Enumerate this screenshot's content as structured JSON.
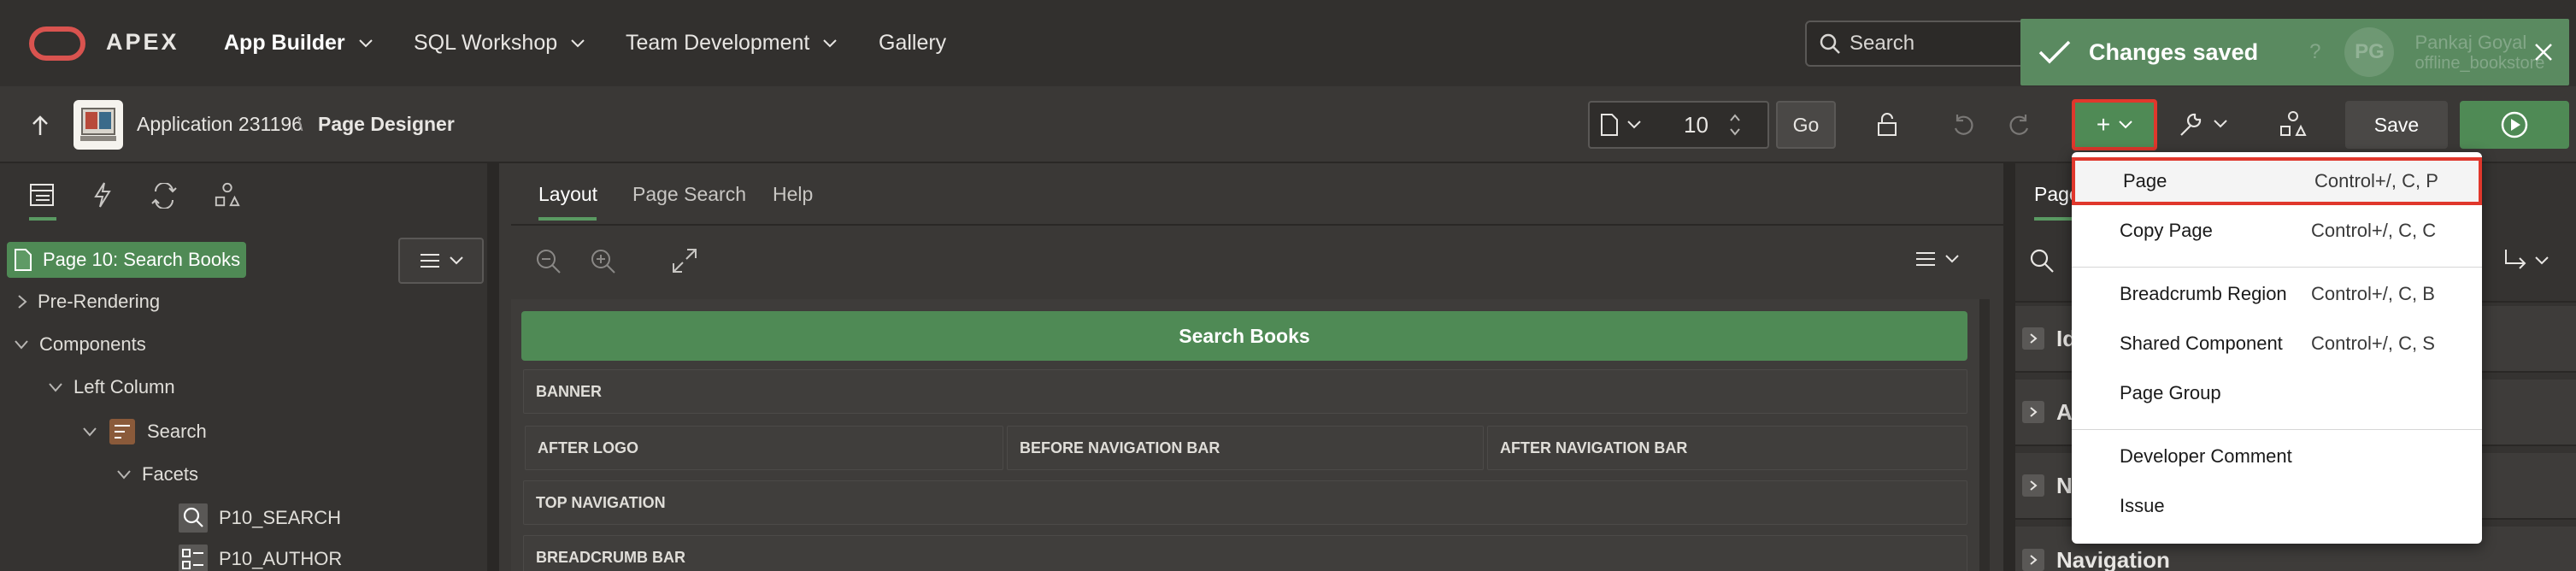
{
  "topnav": {
    "brand": "APEX",
    "items": [
      {
        "label": "App Builder",
        "has_menu": true
      },
      {
        "label": "SQL Workshop",
        "has_menu": true
      },
      {
        "label": "Team Development",
        "has_menu": true
      },
      {
        "label": "Gallery",
        "has_menu": false
      }
    ],
    "search_placeholder": "Search",
    "user_name": "Pankaj Goyal",
    "user_initials": "PG",
    "user_workspace": "offline_bookstore"
  },
  "toast": {
    "message": "Changes saved"
  },
  "toolbar": {
    "app_name": "Application 231196",
    "separator": "\\",
    "current": "Page Designer",
    "page_number": "10",
    "go_label": "Go",
    "save_label": "Save",
    "create_symbol": "+"
  },
  "left_panel": {
    "page_chip": "Page 10: Search Books",
    "tree": [
      {
        "label": "Pre-Rendering"
      },
      {
        "label": "Components"
      },
      {
        "label": "Left Column"
      },
      {
        "label": "Search"
      },
      {
        "label": "Facets"
      },
      {
        "label": "P10_SEARCH"
      },
      {
        "label": "P10_AUTHOR"
      }
    ]
  },
  "center_panel": {
    "tabs": [
      "Layout",
      "Page Search",
      "Help"
    ],
    "active_tab": "Layout",
    "page_title": "Search Books",
    "regions": {
      "banner": "BANNER",
      "after_logo": "AFTER LOGO",
      "before_nav": "BEFORE NAVIGATION BAR",
      "after_nav": "AFTER NAVIGATION BAR",
      "top_nav": "TOP NAVIGATION",
      "breadcrumb": "BREADCRUMB BAR"
    }
  },
  "right_panel": {
    "tab_partial": "Page",
    "sections": [
      {
        "label": "Id"
      },
      {
        "label": "Ap"
      },
      {
        "label": "Na"
      },
      {
        "label": "Navigation"
      }
    ]
  },
  "create_menu": {
    "items": [
      {
        "label": "Page",
        "shortcut": "Control+/, C, P",
        "highlighted": true
      },
      {
        "label": "Copy Page",
        "shortcut": "Control+/, C, C"
      },
      {
        "label": "Breadcrumb Region",
        "shortcut": "Control+/, C, B"
      },
      {
        "label": "Shared Component",
        "shortcut": "Control+/, C, S"
      },
      {
        "label": "Page Group",
        "shortcut": ""
      },
      {
        "label": "Developer Comment",
        "shortcut": ""
      },
      {
        "label": "Issue",
        "shortcut": ""
      }
    ]
  },
  "colors": {
    "accent_green": "#4f8a55",
    "highlight_red": "#e0372c",
    "oracle_red": "#d9534f",
    "dark_bg": "#32302e"
  }
}
